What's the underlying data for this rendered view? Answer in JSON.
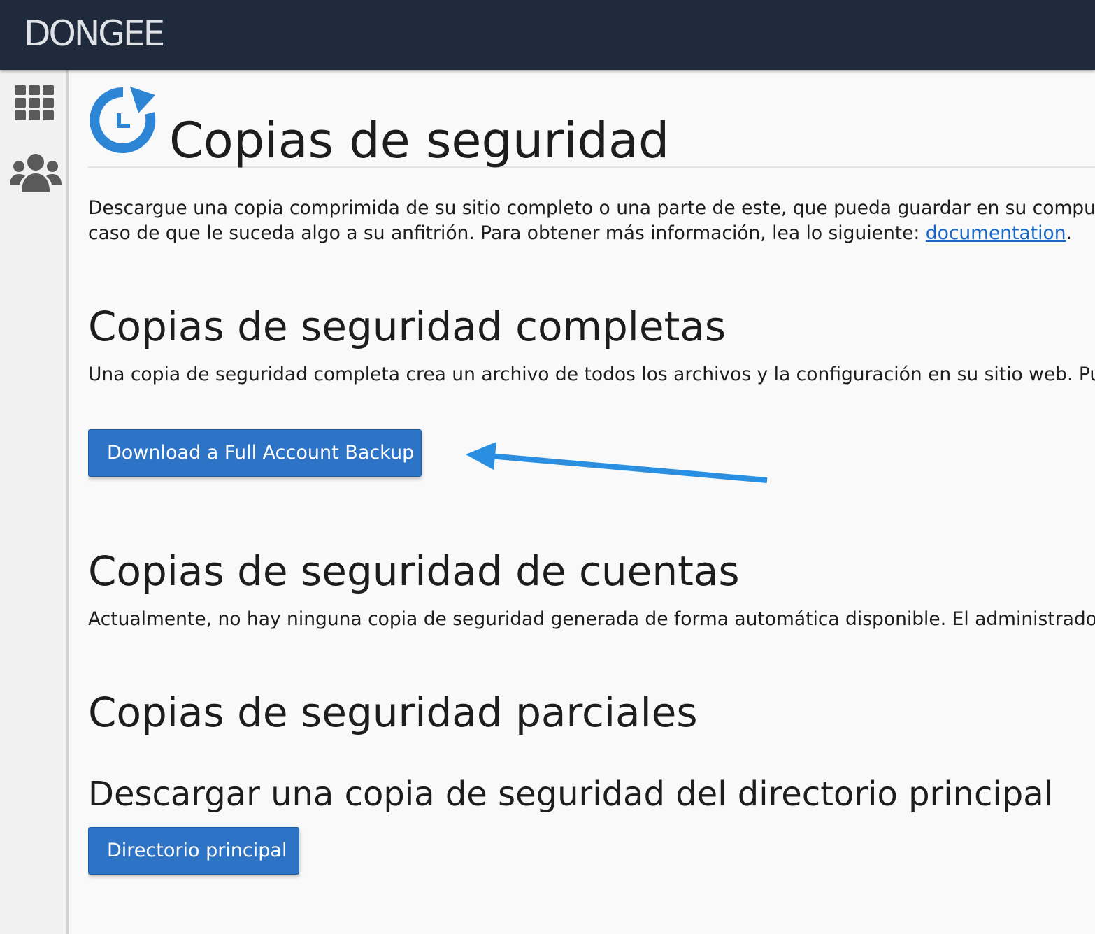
{
  "header": {
    "logo_text": "DONGEE"
  },
  "sidebar": {
    "items": [
      {
        "icon": "grid-icon"
      },
      {
        "icon": "users-icon"
      }
    ],
    "icon_color": "#5a5a5a"
  },
  "page": {
    "title": "Copias de seguridad",
    "title_icon": "backup-clock-icon",
    "icon_color": "#2d85d6",
    "intro_line1": "Descargue una copia comprimida de su sitio completo o una parte de este, que pueda guardar en su computadora en",
    "intro_line2_prefix": "caso de que le suceda algo a su anfitrión. Para obtener más información, lea lo siguiente: ",
    "intro_link": "documentation",
    "intro_line2_suffix": "."
  },
  "full_backups": {
    "heading": "Copias de seguridad completas",
    "description": "Una copia de seguridad completa crea un archivo de todos los archivos y la configuración en su sitio web. Puede",
    "button_label": "Download a Full Account Backup",
    "annotation_color": "#2a8fe0"
  },
  "account_backups": {
    "heading": "Copias de seguridad de cuentas",
    "description": "Actualmente, no hay ninguna copia de seguridad generada de forma automática disponible. El administrador del"
  },
  "partial_backups": {
    "heading": "Copias de seguridad parciales",
    "subheading": "Descargar una copia de seguridad del directorio principal",
    "button_label": "Directorio principal"
  }
}
